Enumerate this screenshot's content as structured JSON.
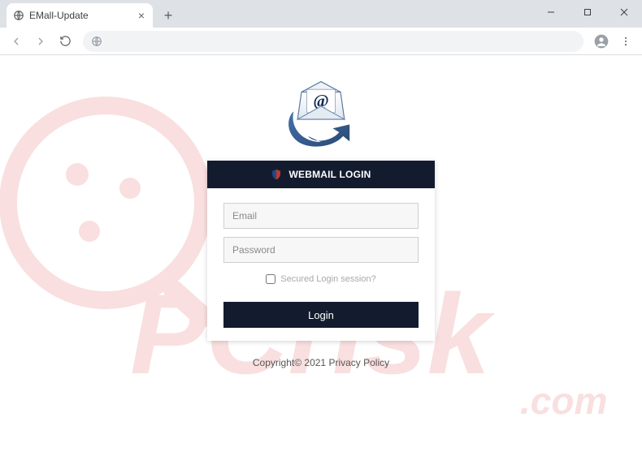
{
  "browser": {
    "tab_title": "EMall-Update",
    "address": ""
  },
  "login": {
    "header": "WEBMAIL LOGIN",
    "email_placeholder": "Email",
    "password_placeholder": "Password",
    "session_label": "Secured Login session?",
    "button_label": "Login"
  },
  "footer": {
    "text": "Copyright© 2021 Privacy Policy"
  },
  "watermark": {
    "text": "PCrisk.com"
  }
}
